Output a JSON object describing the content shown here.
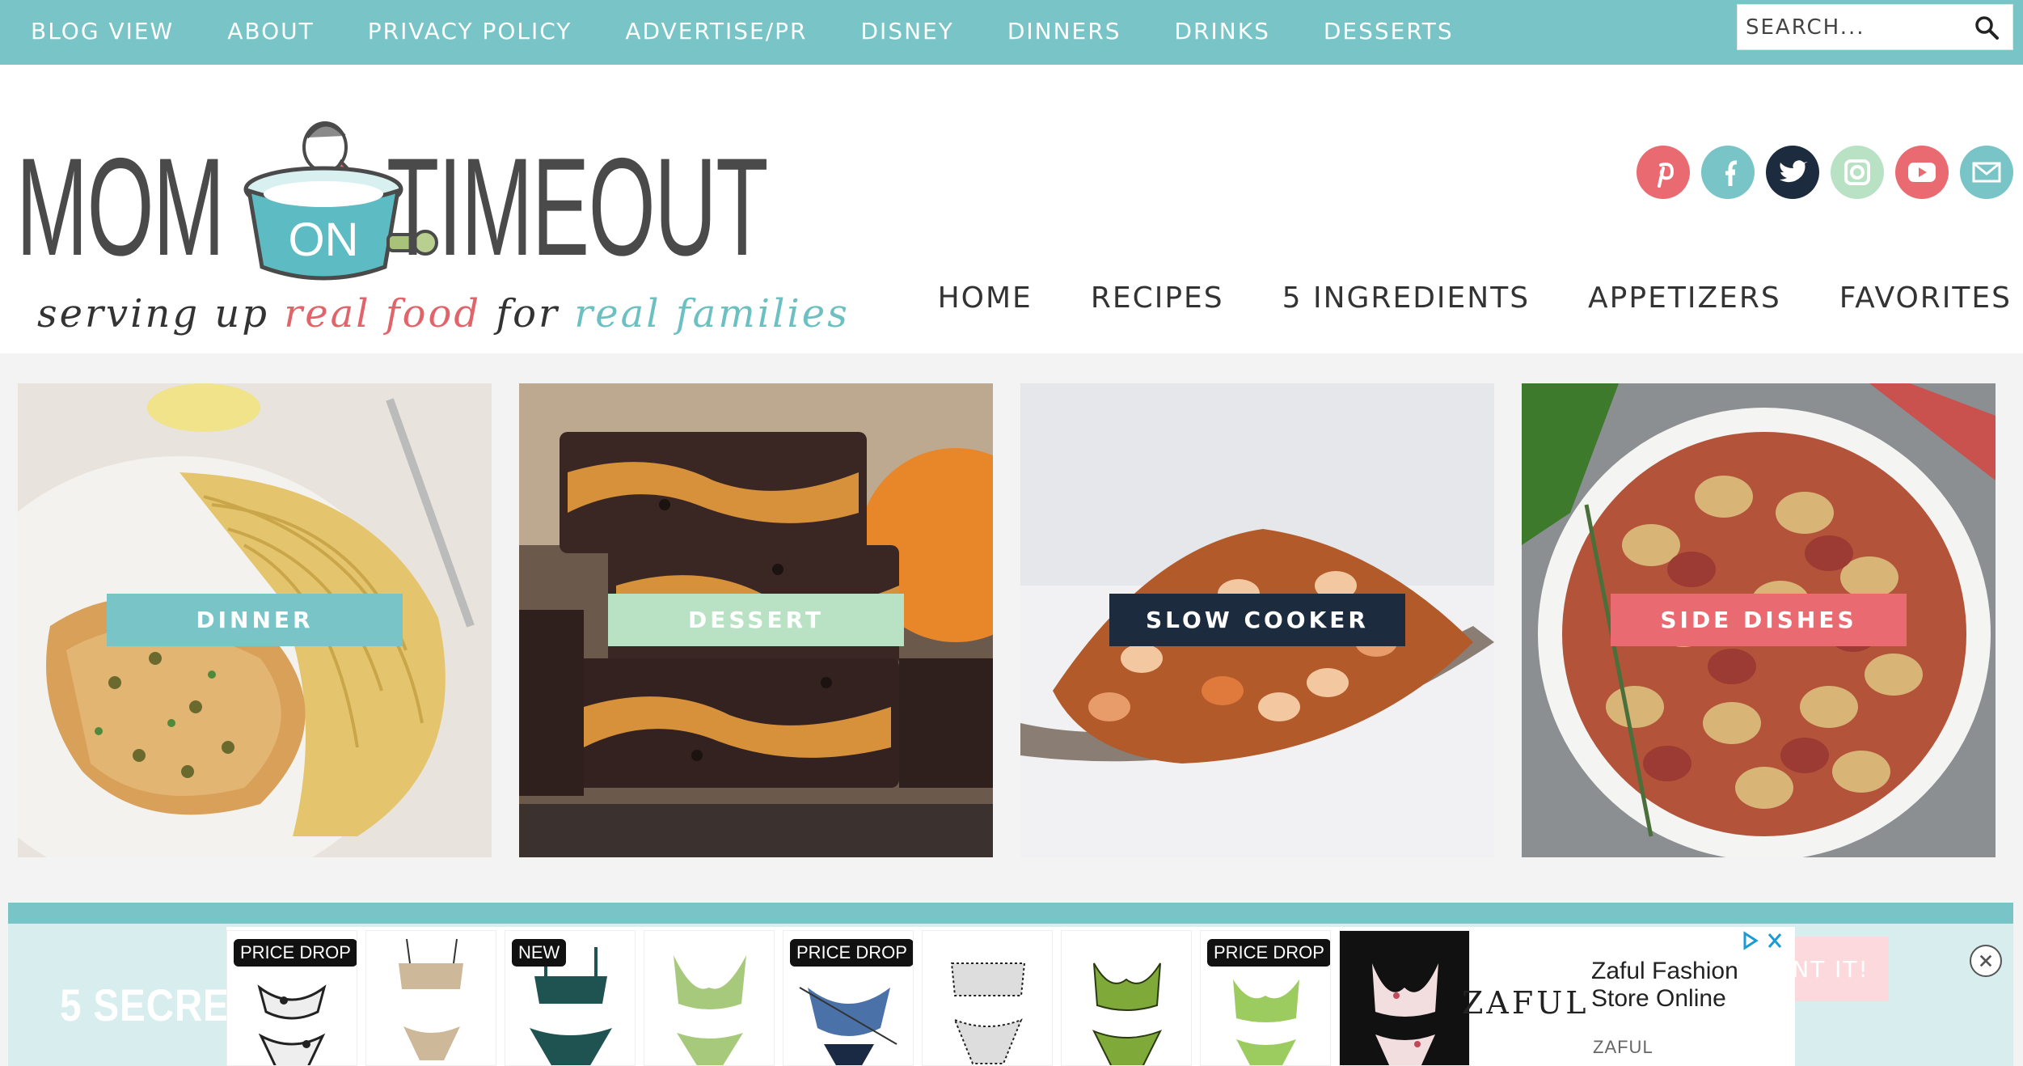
{
  "topnav": {
    "items": [
      "BLOG VIEW",
      "ABOUT",
      "PRIVACY POLICY",
      "ADVERTISE/PR",
      "DISNEY",
      "DINNERS",
      "DRINKS",
      "DESSERTS"
    ],
    "search_placeholder": "SEARCH..."
  },
  "logo": {
    "left_word": "MOM",
    "pot_word": "ON",
    "right_word": "TIMEOUT",
    "tagline_1": "serving up ",
    "tagline_2": "real food",
    "tagline_3": " for ",
    "tagline_4": "real families"
  },
  "social": {
    "icons": [
      "pinterest-icon",
      "facebook-icon",
      "twitter-icon",
      "instagram-icon",
      "youtube-icon",
      "email-icon"
    ],
    "colors": [
      "#e96a70",
      "#78c4c7",
      "#1d2b3e",
      "#b9e2c4",
      "#e96a70",
      "#78c4c7"
    ]
  },
  "mainnav": {
    "items": [
      "HOME",
      "RECIPES",
      "5 INGREDIENTS",
      "APPETIZERS",
      "FAVORITES"
    ]
  },
  "cards": [
    {
      "label": "DINNER",
      "color": "#78c4c7"
    },
    {
      "label": "DESSERT",
      "color": "#b9e2c4"
    },
    {
      "label": "SLOW COOKER",
      "color": "#1d2b3e"
    },
    {
      "label": "SIDE DISHES",
      "color": "#e96a70"
    }
  ],
  "promo": {
    "headline": "5 SECRET",
    "button": "NT IT!"
  },
  "ad": {
    "badges": [
      "PRICE DROP",
      "",
      "NEW",
      "",
      "PRICE DROP",
      "",
      "",
      "PRICE DROP",
      ""
    ],
    "brand": "ZAFUL",
    "title": "Zaful Fashion Store Online",
    "source": "ZAFUL"
  }
}
